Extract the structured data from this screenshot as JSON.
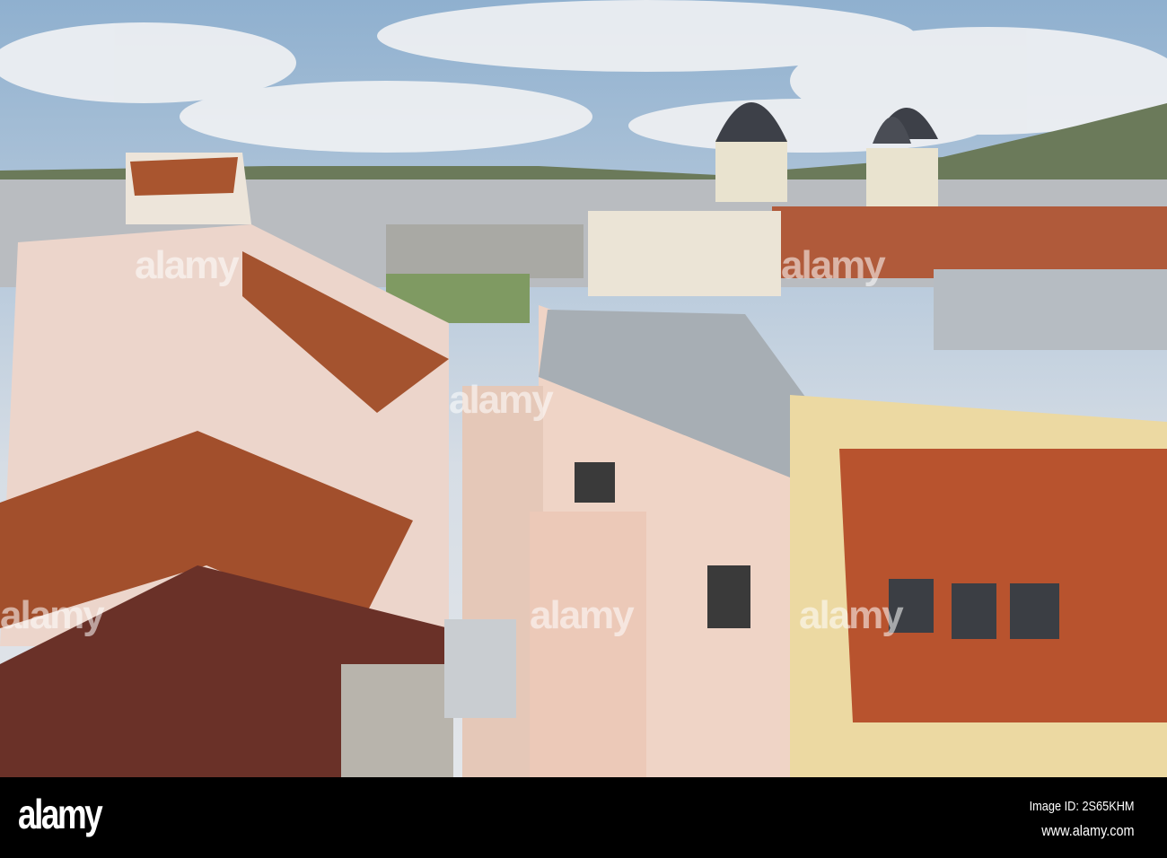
{
  "watermark": {
    "text": "alamy"
  },
  "footer": {
    "logo": "alamy",
    "image_id": "Image ID: 2S65KHM",
    "url": "www.alamy.com"
  }
}
